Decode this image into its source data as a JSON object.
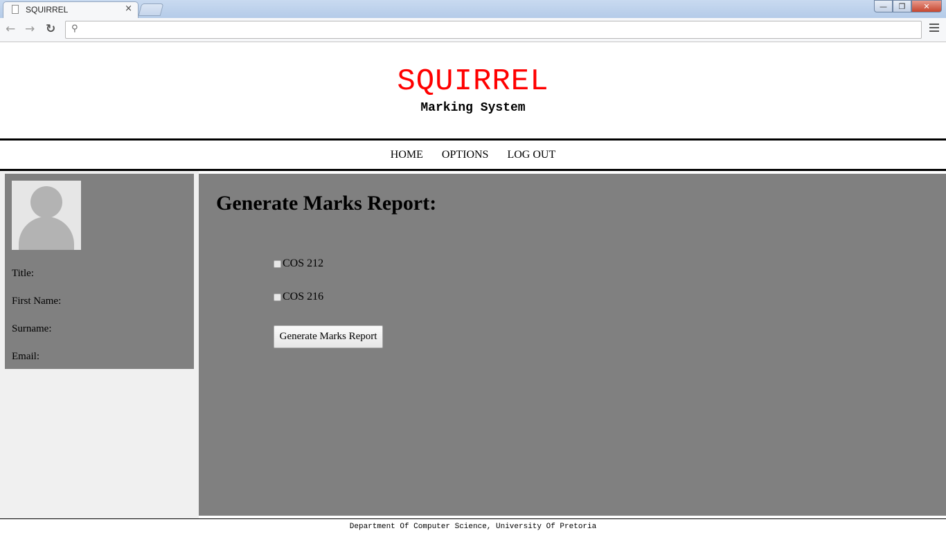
{
  "browser": {
    "tab_title": "SQUIRREL",
    "tab_close": "×",
    "address_value": "",
    "icons": {
      "back": "arrow-left-icon",
      "forward": "arrow-right-icon",
      "reload": "reload-icon",
      "search": "search-icon",
      "menu": "hamburger-menu-icon"
    }
  },
  "header": {
    "title": "SQUIRREL",
    "subtitle": "Marking System",
    "title_color": "#ff0000"
  },
  "nav": {
    "items": [
      {
        "label": "HOME"
      },
      {
        "label": "OPTIONS"
      },
      {
        "label": "LOG OUT"
      }
    ]
  },
  "profile": {
    "avatar_icon": "user-avatar-icon",
    "fields": [
      {
        "label": "Title:"
      },
      {
        "label": "First Name:"
      },
      {
        "label": "Surname:"
      },
      {
        "label": "Email:"
      }
    ]
  },
  "main": {
    "heading": "Generate Marks Report:",
    "courses": [
      {
        "label": "COS 212",
        "checked": false
      },
      {
        "label": "COS 216",
        "checked": false
      }
    ],
    "button_label": "Generate Marks Report",
    "panel_color": "#808080"
  },
  "footer": {
    "text": "Department Of Computer Science, University Of Pretoria"
  }
}
